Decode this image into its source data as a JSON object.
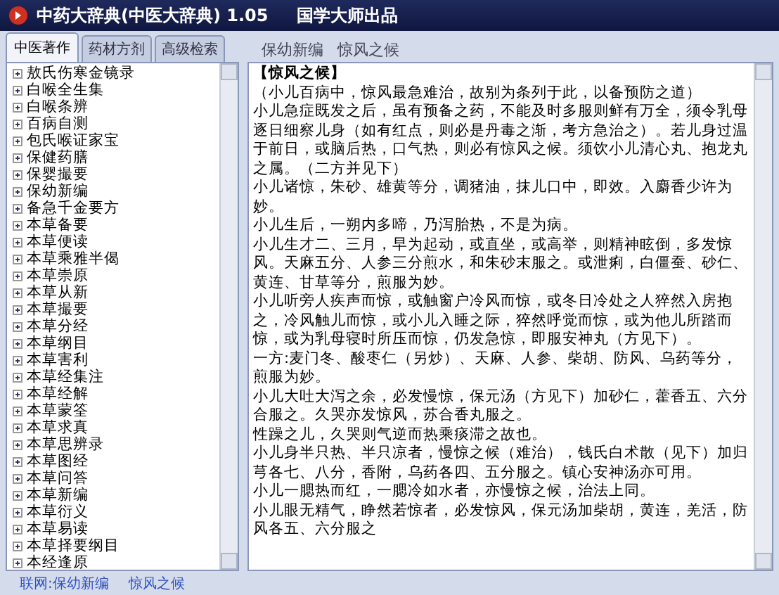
{
  "window": {
    "title": "中药大辞典(中医大辞典) 1.05",
    "publisher": "国学大师出品"
  },
  "tabs": [
    {
      "label": "中医著作",
      "selected": true
    },
    {
      "label": "药材方剂",
      "selected": false
    },
    {
      "label": "高级检索",
      "selected": false
    }
  ],
  "tree": {
    "items": [
      {
        "label": "敖氏伤寒金镜录",
        "expanded": false
      },
      {
        "label": "白喉全生集",
        "expanded": false
      },
      {
        "label": "白喉条辨",
        "expanded": false
      },
      {
        "label": "百病自测",
        "expanded": false
      },
      {
        "label": "包氏喉证家宝",
        "expanded": false
      },
      {
        "label": "保健药膳",
        "expanded": false
      },
      {
        "label": "保婴撮要",
        "expanded": false
      },
      {
        "label": "保幼新编",
        "expanded": false
      },
      {
        "label": "备急千金要方",
        "expanded": false
      },
      {
        "label": "本草备要",
        "expanded": false
      },
      {
        "label": "本草便读",
        "expanded": false
      },
      {
        "label": "本草乘雅半偈",
        "expanded": false
      },
      {
        "label": "本草崇原",
        "expanded": false
      },
      {
        "label": "本草从新",
        "expanded": false
      },
      {
        "label": "本草撮要",
        "expanded": false
      },
      {
        "label": "本草分经",
        "expanded": false
      },
      {
        "label": "本草纲目",
        "expanded": false
      },
      {
        "label": "本草害利",
        "expanded": false
      },
      {
        "label": "本草经集注",
        "expanded": false
      },
      {
        "label": "本草经解",
        "expanded": false
      },
      {
        "label": "本草蒙筌",
        "expanded": false
      },
      {
        "label": "本草求真",
        "expanded": false
      },
      {
        "label": "本草思辨录",
        "expanded": false
      },
      {
        "label": "本草图经",
        "expanded": false
      },
      {
        "label": "本草问答",
        "expanded": false
      },
      {
        "label": "本草新编",
        "expanded": false
      },
      {
        "label": "本草衍义",
        "expanded": false
      },
      {
        "label": "本草易读",
        "expanded": false
      },
      {
        "label": "本草择要纲目",
        "expanded": false
      },
      {
        "label": "本经逢原",
        "expanded": false
      }
    ]
  },
  "breadcrumb": {
    "book": "保幼新编",
    "chapter": "惊风之候"
  },
  "document": {
    "heading": "【惊风之候】",
    "paragraphs": [
      "（小儿百病中，惊风最急难治，故别为条列于此，以备预防之道）",
      "小儿急症既发之后，虽有预备之药，不能及时多服则鲜有万全，须令乳母逐日细察儿身（如有红点，则必是丹毒之渐，考方急治之）。若儿身过温于前日，或脑后热，口气热，则必有惊风之候。须饮小儿清心丸、抱龙丸之属。（二方并见下）",
      "小儿诸惊，朱砂、雄黄等分，调猪油，抹儿口中，即效。入麝香少许为妙。",
      "小儿生后，一朔内多啼，乃泻胎热，不是为病。",
      "小儿生才二、三月，早为起动，或直坐，或高举，则精神眩倒，多发惊风。天麻五分、人参三分煎水，和朱砂末服之。或泄痢，白僵蚕、砂仁、黄连、甘草等分，煎服为妙。",
      "小儿听旁人疾声而惊，或触窗户冷风而惊，或冬日冷处之人猝然入房抱之，冷风触儿而惊，或小儿入睡之际，猝然呼觉而惊，或为他儿所踏而惊，或为乳母寝时所压而惊，仍发急惊，即服安神丸（方见下）。",
      "一方:麦门冬、酸枣仁（另炒）、天麻、人参、柴胡、防风、乌药等分，煎服为妙。",
      "小儿大吐大泻之余，必发慢惊，保元汤（方见下）加砂仁，藿香五、六分合服之。久哭亦发惊风，苏合香丸服之。",
      "性躁之儿，久哭则气逆而热乘痰滞之故也。",
      "小儿身半只热、半只凉者，慢惊之候（难治），钱氏白术散（见下）加归芎各七、八分，香附，乌药各四、五分服之。镇心安神汤亦可用。",
      "小儿一腮热而红，一腮冷如水者，亦慢惊之候，治法上同。",
      "小儿眼无精气，睁然若惊者，必发惊风，保元汤加柴胡，黄连，羌活，防风各五、六分服之"
    ]
  },
  "status_bar": {
    "label": "联网:保幼新编",
    "chapter": "惊风之候"
  }
}
